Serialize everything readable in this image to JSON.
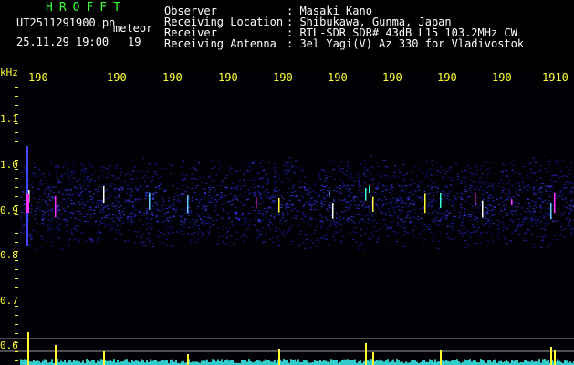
{
  "header": {
    "app_title": "HROFFT",
    "filename": "UT2511291900.pn",
    "mode": "meteor",
    "datetime": "25.11.29 19:00",
    "minute_marker": "19",
    "observer_label": "Observer",
    "observer_value": ": Masaki Kano",
    "location_label": "Receiving Location",
    "location_value": ": Shibukawa, Gunma, Japan",
    "receiver_label": "Receiver",
    "receiver_value": ": RTL-SDR SDR# 43dB L15 103.2MHz CW",
    "antenna_label": "Receiving Antenna",
    "antenna_value": ": 3el Yagi(V) Az 330 for Vladivostok"
  },
  "axis": {
    "unit": "kHz",
    "y_labels": [
      "1.1",
      "1.0",
      "0.9",
      "0.8",
      "0.7",
      "0.6"
    ],
    "x_ticks": [
      "190",
      "190",
      "190",
      "190",
      "190",
      "190",
      "190",
      "190",
      "190",
      "1910"
    ]
  },
  "colors": {
    "background": "#000000",
    "label": "#ffff33",
    "title": "#33ff33",
    "text": "#ffffff"
  }
}
